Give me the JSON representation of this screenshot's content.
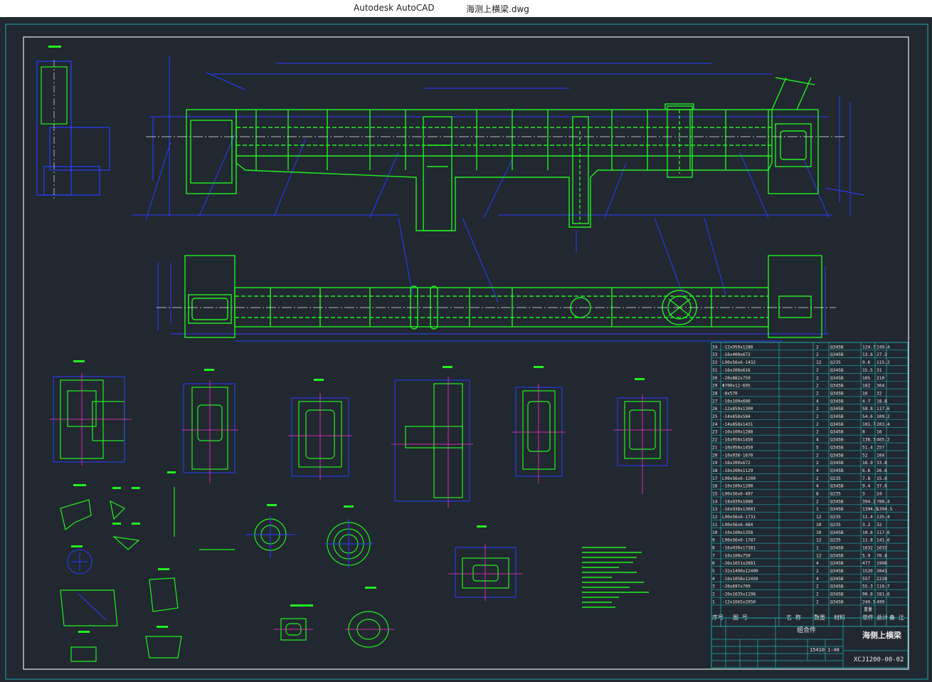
{
  "window": {
    "app_name": "Autodesk AutoCAD",
    "file_name": "海测上横梁.dwg"
  },
  "bom": {
    "rows": [
      {
        "no": "34",
        "spec": "-12x959x1280",
        "qty": "2",
        "mat": "Q345B",
        "unit": "124.7",
        "total": "249.4"
      },
      {
        "no": "33",
        "spec": "-16x400x672",
        "qty": "2",
        "mat": "Q345B",
        "unit": "13.6",
        "total": "27.2"
      },
      {
        "no": "32",
        "spec": "L90x56x6-1432",
        "qty": "12",
        "mat": "Q235",
        "unit": "9.6",
        "total": "115.2"
      },
      {
        "no": "31",
        "spec": "-16x208x616",
        "qty": "2",
        "mat": "Q345B",
        "unit": "15.5",
        "total": "31"
      },
      {
        "no": "30",
        "spec": "-20x882x759",
        "qty": "2",
        "mat": "Q345B",
        "unit": "105",
        "total": "210"
      },
      {
        "no": "29",
        "spec": "Φ700x12-695",
        "qty": "2",
        "mat": "Q345B",
        "unit": "182",
        "total": "364"
      },
      {
        "no": "28",
        "spec": "-8x570",
        "qty": "2",
        "mat": "Q345B",
        "unit": "16",
        "total": "32"
      },
      {
        "no": "27",
        "spec": "-10x100x600",
        "qty": "4",
        "mat": "Q345B",
        "unit": "4.7",
        "total": "18.8"
      },
      {
        "no": "26",
        "spec": "-12x859x1300",
        "qty": "2",
        "mat": "Q345B",
        "unit": "58.8",
        "total": "117.6"
      },
      {
        "no": "25",
        "spec": "-14x658x584",
        "qty": "2",
        "mat": "Q345B",
        "unit": "54.6",
        "total": "109.2"
      },
      {
        "no": "24",
        "spec": "-14x858x1431",
        "qty": "2",
        "mat": "Q345B",
        "unit": "101.7",
        "total": "203.4"
      },
      {
        "no": "23",
        "spec": "-10x100x1288",
        "qty": "2",
        "mat": "Q345B",
        "unit": "8",
        "total": "16"
      },
      {
        "no": "22",
        "spec": "-16x958x1458",
        "qty": "4",
        "mat": "Q345B",
        "unit": "136.3",
        "total": "465.2"
      },
      {
        "no": "21",
        "spec": "-10x958x1450",
        "qty": "5",
        "mat": "Q345B",
        "unit": "51.4",
        "total": "257"
      },
      {
        "no": "20",
        "spec": "-10x938-1670",
        "qty": "2",
        "mat": "Q345B",
        "unit": "52",
        "total": "104"
      },
      {
        "no": "19",
        "spec": "-16x200x672",
        "qty": "2",
        "mat": "Q345B",
        "unit": "16.9",
        "total": "33.8"
      },
      {
        "no": "18",
        "spec": "-10x200x1129",
        "qty": "4",
        "mat": "Q345B",
        "unit": "6.6",
        "total": "26.6"
      },
      {
        "no": "17",
        "spec": "L90x56x6-1200",
        "qty": "2",
        "mat": "Q235",
        "unit": "7.8",
        "total": "15.6"
      },
      {
        "no": "16",
        "spec": "-10x100x1200",
        "qty": "4",
        "mat": "Q345B",
        "unit": "9.4",
        "total": "37.6"
      },
      {
        "no": "15",
        "spec": "L90x56x6-497",
        "qty": "8",
        "mat": "Q235",
        "unit": "3",
        "total": "24"
      },
      {
        "no": "14",
        "spec": "-18x939x1688",
        "qty": "2",
        "mat": "Q345B",
        "unit": "394.2",
        "total": "788.4"
      },
      {
        "no": "13",
        "spec": "-16x938x13681",
        "qty": "1",
        "mat": "Q345B",
        "unit": "1394.5",
        "total": "1394.5"
      },
      {
        "no": "12",
        "spec": "L90x56x6-1731",
        "qty": "12",
        "mat": "Q235",
        "unit": "11.4",
        "total": "135.4"
      },
      {
        "no": "11",
        "spec": "L90x56x6-484",
        "qty": "10",
        "mat": "Q235",
        "unit": "3.2",
        "total": "32"
      },
      {
        "no": "10",
        "spec": "-10x100x1358",
        "qty": "10",
        "mat": "Q345B",
        "unit": "10.6",
        "total": "117.6"
      },
      {
        "no": "9",
        "spec": "L90x56x6-1787",
        "qty": "12",
        "mat": "Q235",
        "unit": "11.8",
        "total": "141.6"
      },
      {
        "no": "8",
        "spec": "-16x930x17381",
        "qty": "1",
        "mat": "Q345B",
        "unit": "1632",
        "total": "1632"
      },
      {
        "no": "7",
        "spec": "-10x100x750",
        "qty": "12",
        "mat": "Q345B",
        "unit": "5.9",
        "total": "70.8"
      },
      {
        "no": "6",
        "spec": "-26x1651x2681",
        "qty": "4",
        "mat": "Q345B",
        "unit": "477",
        "total": "1908"
      },
      {
        "no": "5",
        "spec": "-32x1490x12400",
        "qty": "2",
        "mat": "Q345B",
        "unit": "1520",
        "total": "3041"
      },
      {
        "no": "4",
        "spec": "-16x1058x12450",
        "qty": "4",
        "mat": "Q345B",
        "unit": "557",
        "total": "2228"
      },
      {
        "no": "3",
        "spec": "-20x697x709",
        "qty": "2",
        "mat": "Q345B",
        "unit": "55.3",
        "total": "110.7"
      },
      {
        "no": "2",
        "spec": "-20x1635x1198",
        "qty": "2",
        "mat": "Q345B",
        "unit": "90.8",
        "total": "181.6"
      },
      {
        "no": "1",
        "spec": "-12x1665x2050",
        "qty": "2",
        "mat": "Q345B",
        "unit": "249.5",
        "total": "499"
      }
    ],
    "header": {
      "no": "序号",
      "spec": "图 号",
      "name": "名 称",
      "qty": "数量",
      "mat": "材料",
      "unit": "单件",
      "total": "总计",
      "weight": "重量",
      "remark": "备 注"
    }
  },
  "title_block": {
    "assembly": "组合件",
    "name": "海侧上横梁",
    "drawing_no": "XCJ1200-00-02",
    "weight": "15410",
    "scale": "1:40"
  }
}
